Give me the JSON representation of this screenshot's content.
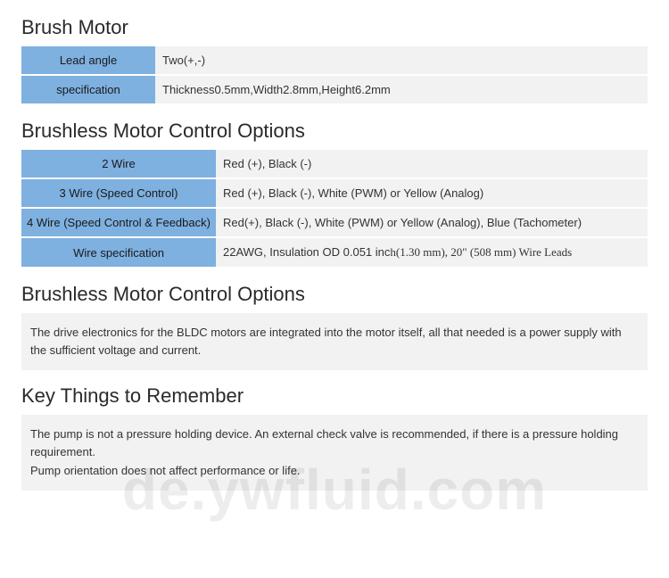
{
  "sections": {
    "brush_motor": {
      "title": "Brush Motor",
      "rows": [
        {
          "label": "Lead angle",
          "value": "Two(+,-)"
        },
        {
          "label": "specification",
          "value": "Thickness0.5mm,Width2.8mm,Height6.2mm"
        }
      ]
    },
    "brushless_options_table": {
      "title": "Brushless Motor Control Options",
      "rows": [
        {
          "label": "2 Wire",
          "value": "Red (+), Black (-)"
        },
        {
          "label": "3 Wire (Speed Control)",
          "value": "Red (+), Black (-), White (PWM) or Yellow (Analog)"
        },
        {
          "label": "4 Wire (Speed Control & Feedback)",
          "value": "Red(+), Black (-), White (PWM) or Yellow (Analog), Blue (Tachometer)"
        },
        {
          "label": "Wire specification",
          "value_pre": "22AWG, Insulation OD 0.051 inc",
          "value_serif": "h(1.30 mm), 20\" (508 mm) Wire Leads"
        }
      ]
    },
    "brushless_options_text": {
      "title": "Brushless Motor Control Options",
      "body": "The drive electronics for the BLDC motors are integrated into the motor itself, all that needed is a power supply with the sufficient voltage and current."
    },
    "key_things": {
      "title": "Key Things to Remember",
      "body1": "The pump is not a pressure holding device. An external check valve is recommended, if there is a pressure holding requirement.",
      "body2": "Pump orientation does not affect performance or life."
    }
  },
  "watermark": "de.ywfluid.com"
}
